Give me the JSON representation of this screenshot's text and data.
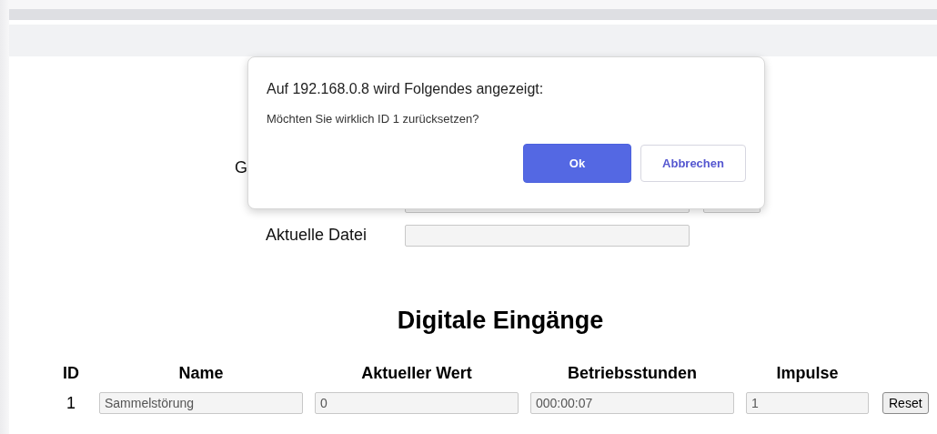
{
  "dialog": {
    "title": "Auf 192.168.0.8 wird Folgendes angezeigt:",
    "message": "Möchten Sie wirklich ID 1 zurücksetzen?",
    "buttons": [
      {
        "label": "Ok",
        "kind": "primary"
      },
      {
        "label": "Abbrechen",
        "kind": "secondary"
      }
    ]
  },
  "form": [
    {
      "kind": "covered",
      "label": "G"
    },
    {
      "kind": "covered-fields"
    },
    {
      "kind": "field",
      "label": "Aktuelle Datei"
    }
  ],
  "section_title": "Digitale Eingänge",
  "table": {
    "columns": [
      "ID",
      "Name",
      "Aktueller Wert",
      "Betriebsstunden",
      "Impulse"
    ],
    "rows": [
      {
        "id": "1",
        "name": "Sammelstörung",
        "value": "0",
        "hours": "000:00:07",
        "pulses": "1",
        "button": "Reset"
      }
    ]
  }
}
